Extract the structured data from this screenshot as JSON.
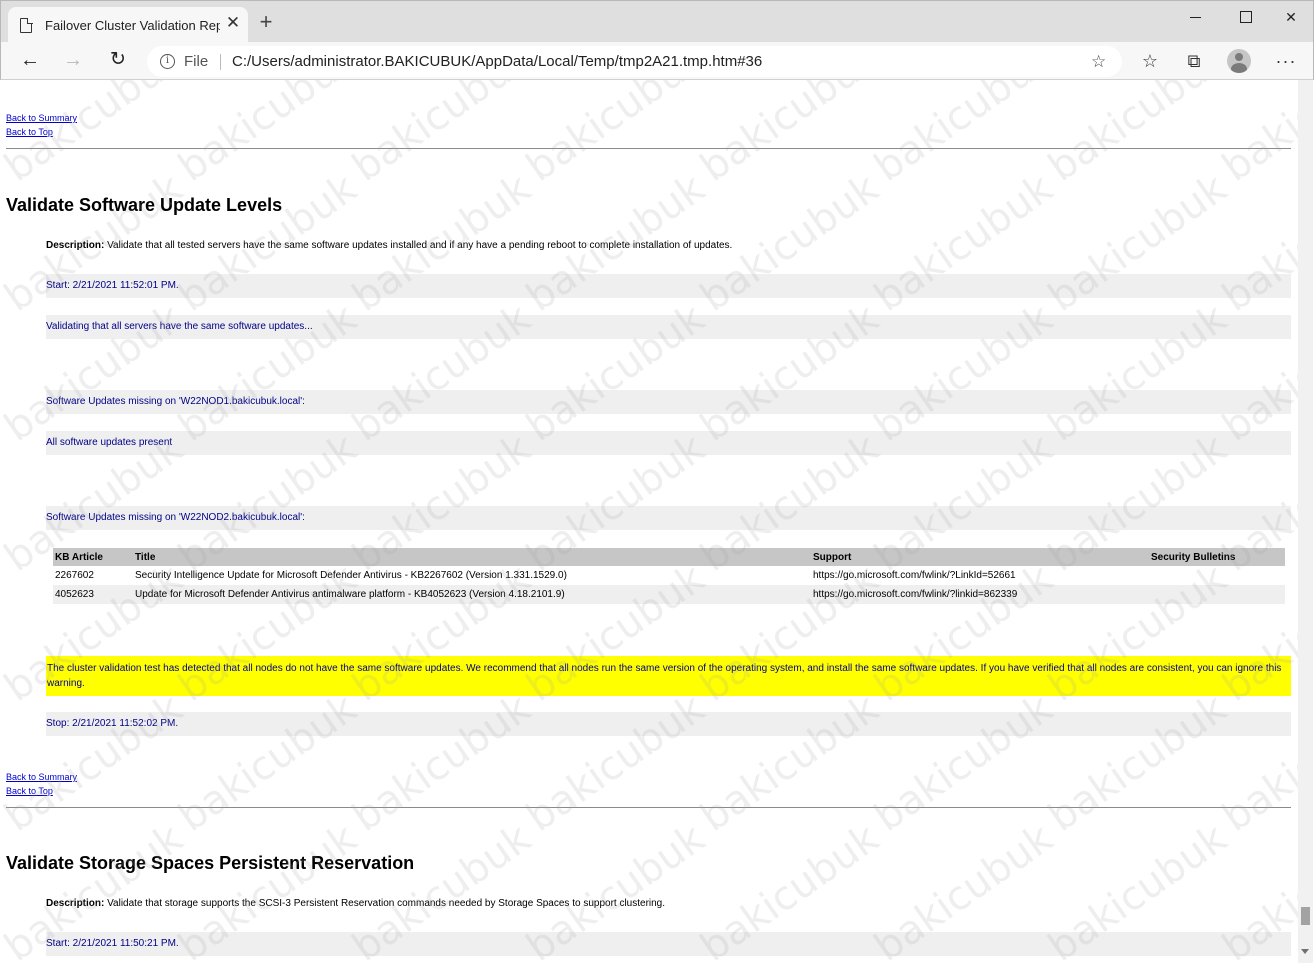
{
  "browser": {
    "tab_title": "Failover Cluster Validation Report",
    "tab_close": "✕",
    "new_tab": "+",
    "file_label": "File",
    "url": "C:/Users/administrator.BAKICUBUK/AppData/Local/Temp/tmp2A21.tmp.htm#36",
    "icons": {
      "back": "←",
      "forward": "→",
      "reload": "↻",
      "info": "i",
      "favorite_add": "☆",
      "favorites": "☆",
      "collections": "⧉",
      "more": "···",
      "close": "✕"
    }
  },
  "page": {
    "back_to_summary": "Back to Summary",
    "back_to_top": "Back to Top",
    "section1": {
      "title": "Validate Software Update Levels",
      "description_label": "Description:",
      "description": "Validate that all tested servers have the same software updates installed and if any have a pending reboot to complete installation of updates.",
      "start": "Start: 2/21/2021 11:52:01 PM.",
      "validating": "Validating that all servers have the same software updates...",
      "missing_node1": "Software Updates missing on 'W22NOD1.bakicubuk.local':",
      "all_present": "All software updates present",
      "missing_node2": "Software Updates missing on 'W22NOD2.bakicubuk.local':",
      "table": {
        "headers": [
          "KB Article",
          "Title",
          "Support",
          "Security Bulletins"
        ],
        "rows": [
          [
            "2267602",
            "Security Intelligence Update for Microsoft Defender Antivirus - KB2267602 (Version 1.331.1529.0)",
            "https://go.microsoft.com/fwlink/?LinkId=52661",
            ""
          ],
          [
            "4052623",
            "Update for Microsoft Defender Antivirus antimalware platform - KB4052623 (Version 4.18.2101.9)",
            "https://go.microsoft.com/fwlink/?linkid=862339",
            ""
          ]
        ]
      },
      "warning": "The cluster validation test has detected that all nodes do not have the same software updates. We recommend that all nodes run the same version of the operating system, and install the same software updates. If you have verified that all nodes are consistent, you can ignore this warning.",
      "stop": "Stop: 2/21/2021 11:52:02 PM."
    },
    "section2": {
      "title": "Validate Storage Spaces Persistent Reservation",
      "description_label": "Description:",
      "description": "Validate that storage supports the SCSI-3 Persistent Reservation commands needed by Storage Spaces to support clustering.",
      "start": "Start: 2/21/2021 11:50:21 PM."
    },
    "watermark": "bakicubuk"
  }
}
